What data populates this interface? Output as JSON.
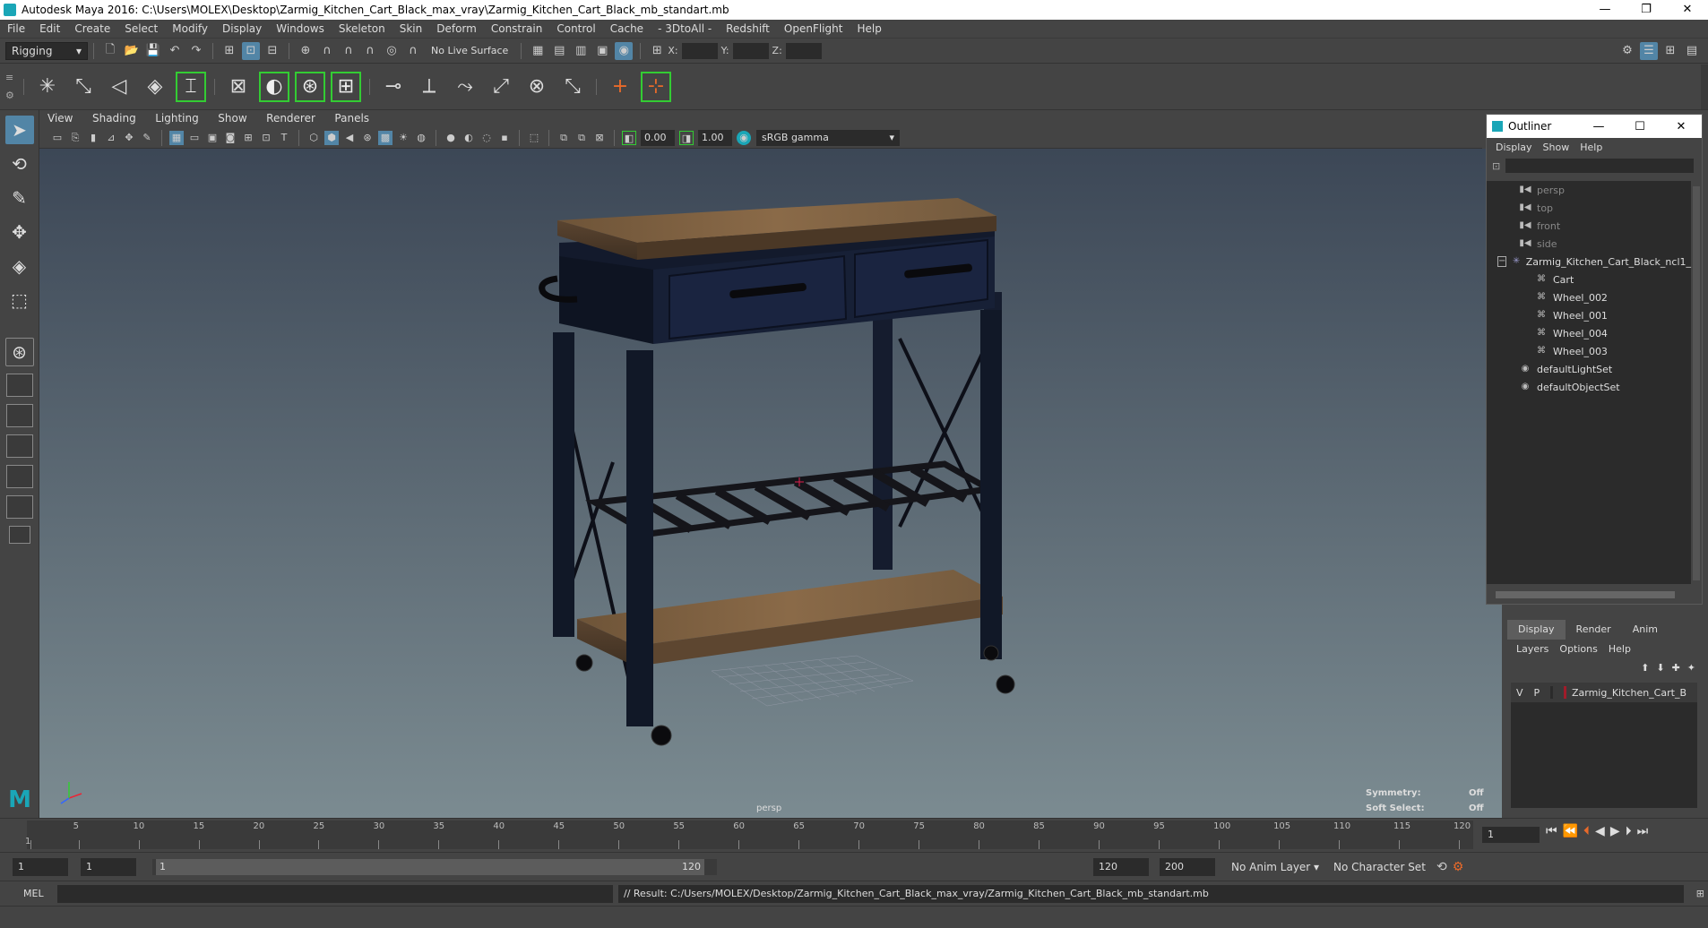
{
  "window": {
    "title": "Autodesk Maya 2016: C:\\Users\\MOLEX\\Desktop\\Zarmig_Kitchen_Cart_Black_max_vray\\Zarmig_Kitchen_Cart_Black_mb_standart.mb"
  },
  "menu": [
    "File",
    "Edit",
    "Create",
    "Select",
    "Modify",
    "Display",
    "Windows",
    "Skeleton",
    "Skin",
    "Deform",
    "Constrain",
    "Control",
    "Cache",
    "- 3DtoAll -",
    "Redshift",
    "OpenFlight",
    "Help"
  ],
  "status": {
    "mode": "Rigging",
    "live_surface": "No Live Surface",
    "x_label": "X:",
    "y_label": "Y:",
    "z_label": "Z:"
  },
  "panel_menu": [
    "View",
    "Shading",
    "Lighting",
    "Show",
    "Renderer",
    "Panels"
  ],
  "panel_toolbar": {
    "exposure": "0.00",
    "gamma_value": "1.00",
    "colorspace": "sRGB gamma"
  },
  "viewport": {
    "camera": "persp",
    "symmetry_label": "Symmetry:",
    "symmetry_value": "Off",
    "softselect_label": "Soft Select:",
    "softselect_value": "Off"
  },
  "outliner": {
    "title": "Outliner",
    "menu": [
      "Display",
      "Show",
      "Help"
    ],
    "items": [
      {
        "label": "persp",
        "dim": true,
        "indent": 1
      },
      {
        "label": "top",
        "dim": true,
        "indent": 1
      },
      {
        "label": "front",
        "dim": true,
        "indent": 1
      },
      {
        "label": "side",
        "dim": true,
        "indent": 1
      },
      {
        "label": "Zarmig_Kitchen_Cart_Black_ncl1_",
        "dim": false,
        "indent": 0
      },
      {
        "label": "Cart",
        "dim": false,
        "indent": 2
      },
      {
        "label": "Wheel_002",
        "dim": false,
        "indent": 2
      },
      {
        "label": "Wheel_001",
        "dim": false,
        "indent": 2
      },
      {
        "label": "Wheel_004",
        "dim": false,
        "indent": 2
      },
      {
        "label": "Wheel_003",
        "dim": false,
        "indent": 2
      },
      {
        "label": "defaultLightSet",
        "dim": false,
        "indent": 1
      },
      {
        "label": "defaultObjectSet",
        "dim": false,
        "indent": 1
      }
    ]
  },
  "layers": {
    "tabs": [
      "Display",
      "Render",
      "Anim"
    ],
    "menu": [
      "Layers",
      "Options",
      "Help"
    ],
    "row": {
      "v": "V",
      "p": "P",
      "name": "Zarmig_Kitchen_Cart_B",
      "color": "#a01c2a"
    }
  },
  "timeline": {
    "ticks": [
      1,
      5,
      10,
      15,
      20,
      25,
      30,
      35,
      40,
      45,
      50,
      55,
      60,
      65,
      70,
      75,
      80,
      85,
      90,
      95,
      100,
      105,
      110,
      115,
      120
    ],
    "current_frame": "1"
  },
  "range": {
    "start": "1",
    "playback_start": "1",
    "range_start": "1",
    "range_end": "120",
    "playback_end": "120",
    "end": "200",
    "anim_layer": "No Anim Layer",
    "char_set": "No Character Set"
  },
  "command": {
    "lang": "MEL",
    "result": "// Result: C:/Users/MOLEX/Desktop/Zarmig_Kitchen_Cart_Black_max_vray/Zarmig_Kitchen_Cart_Black_mb_standart.mb"
  }
}
